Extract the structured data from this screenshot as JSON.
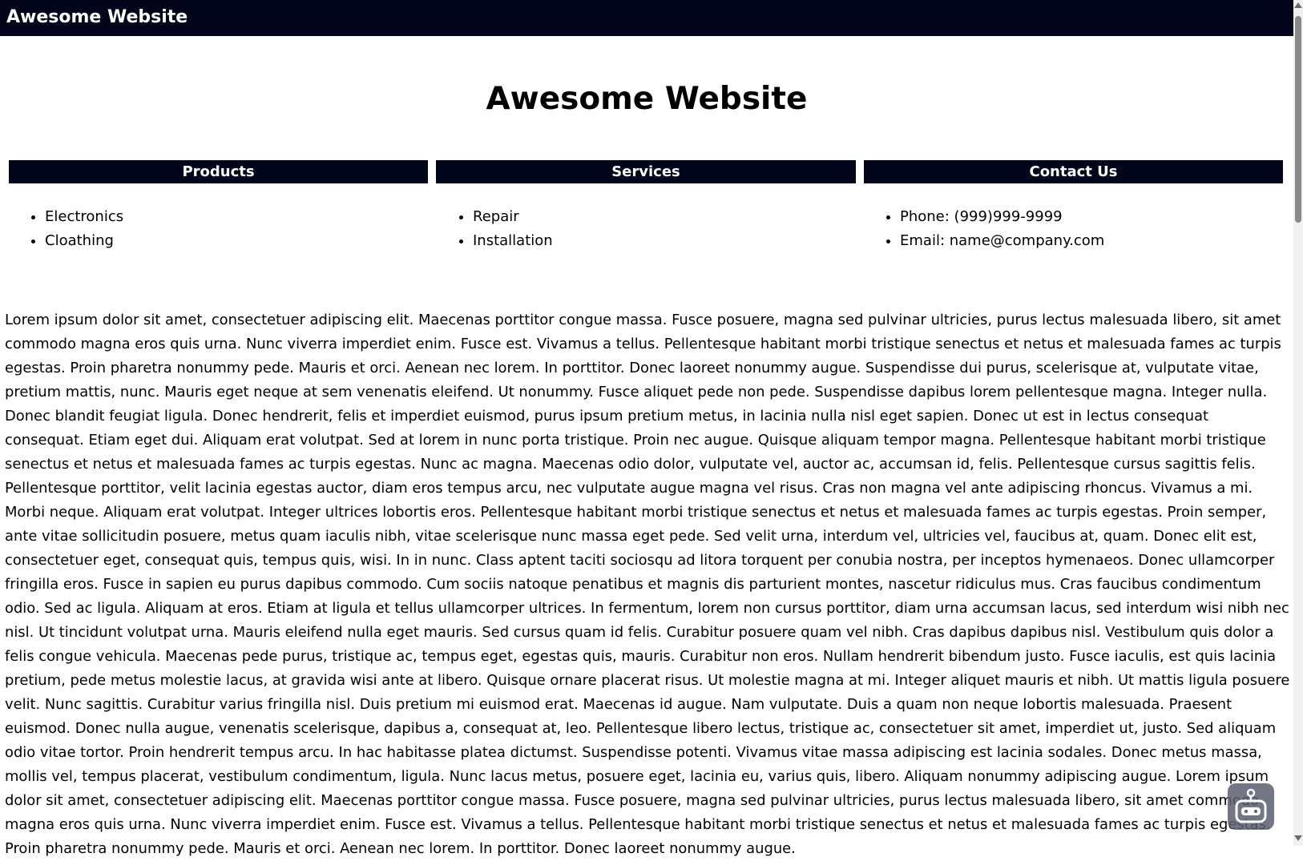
{
  "site": {
    "title": "Awesome Website"
  },
  "hero": {
    "title": "Awesome Website"
  },
  "columns": [
    {
      "header": "Products",
      "items": [
        "Electronics",
        "Cloathing"
      ]
    },
    {
      "header": "Services",
      "items": [
        "Repair",
        "Installation"
      ]
    },
    {
      "header": "Contact Us",
      "items": [
        "Phone: (999)999-9999",
        "Email: name@company.com"
      ]
    }
  ],
  "body_text": "Lorem ipsum dolor sit amet, consectetuer adipiscing elit. Maecenas porttitor congue massa. Fusce posuere, magna sed pulvinar ultricies, purus lectus malesuada libero, sit amet commodo magna eros quis urna. Nunc viverra imperdiet enim. Fusce est. Vivamus a tellus. Pellentesque habitant morbi tristique senectus et netus et malesuada fames ac turpis egestas. Proin pharetra nonummy pede. Mauris et orci. Aenean nec lorem. In porttitor. Donec laoreet nonummy augue. Suspendisse dui purus, scelerisque at, vulputate vitae, pretium mattis, nunc. Mauris eget neque at sem venenatis eleifend. Ut nonummy. Fusce aliquet pede non pede. Suspendisse dapibus lorem pellentesque magna. Integer nulla. Donec blandit feugiat ligula. Donec hendrerit, felis et imperdiet euismod, purus ipsum pretium metus, in lacinia nulla nisl eget sapien. Donec ut est in lectus consequat consequat. Etiam eget dui. Aliquam erat volutpat. Sed at lorem in nunc porta tristique. Proin nec augue. Quisque aliquam tempor magna. Pellentesque habitant morbi tristique senectus et netus et malesuada fames ac turpis egestas. Nunc ac magna. Maecenas odio dolor, vulputate vel, auctor ac, accumsan id, felis. Pellentesque cursus sagittis felis. Pellentesque porttitor, velit lacinia egestas auctor, diam eros tempus arcu, nec vulputate augue magna vel risus. Cras non magna vel ante adipiscing rhoncus. Vivamus a mi. Morbi neque. Aliquam erat volutpat. Integer ultrices lobortis eros. Pellentesque habitant morbi tristique senectus et netus et malesuada fames ac turpis egestas. Proin semper, ante vitae sollicitudin posuere, metus quam iaculis nibh, vitae scelerisque nunc massa eget pede. Sed velit urna, interdum vel, ultricies vel, faucibus at, quam. Donec elit est, consectetuer eget, consequat quis, tempus quis, wisi. In in nunc. Class aptent taciti sociosqu ad litora torquent per conubia nostra, per inceptos hymenaeos. Donec ullamcorper fringilla eros. Fusce in sapien eu purus dapibus commodo. Cum sociis natoque penatibus et magnis dis parturient montes, nascetur ridiculus mus. Cras faucibus condimentum odio. Sed ac ligula. Aliquam at eros. Etiam at ligula et tellus ullamcorper ultrices. In fermentum, lorem non cursus porttitor, diam urna accumsan lacus, sed interdum wisi nibh nec nisl. Ut tincidunt volutpat urna. Mauris eleifend nulla eget mauris. Sed cursus quam id felis. Curabitur posuere quam vel nibh. Cras dapibus dapibus nisl. Vestibulum quis dolor a felis congue vehicula. Maecenas pede purus, tristique ac, tempus eget, egestas quis, mauris. Curabitur non eros. Nullam hendrerit bibendum justo. Fusce iaculis, est quis lacinia pretium, pede metus molestie lacus, at gravida wisi ante at libero. Quisque ornare placerat risus. Ut molestie magna at mi. Integer aliquet mauris et nibh. Ut mattis ligula posuere velit. Nunc sagittis. Curabitur varius fringilla nisl. Duis pretium mi euismod erat. Maecenas id augue. Nam vulputate. Duis a quam non neque lobortis malesuada. Praesent euismod. Donec nulla augue, venenatis scelerisque, dapibus a, consequat at, leo. Pellentesque libero lectus, tristique ac, consectetuer sit amet, imperdiet ut, justo. Sed aliquam odio vitae tortor. Proin hendrerit tempus arcu. In hac habitasse platea dictumst. Suspendisse potenti. Vivamus vitae massa adipiscing est lacinia sodales. Donec metus massa, mollis vel, tempus placerat, vestibulum condimentum, ligula. Nunc lacus metus, posuere eget, lacinia eu, varius quis, libero. Aliquam nonummy adipiscing augue. Lorem ipsum dolor sit amet, consectetuer adipiscing elit. Maecenas porttitor congue massa. Fusce posuere, magna sed pulvinar ultricies, purus lectus malesuada libero, sit amet commodo magna eros quis urna. Nunc viverra imperdiet enim. Fusce est. Vivamus a tellus. Pellentesque habitant morbi tristique senectus et netus et malesuada fames ac turpis egestas. Proin pharetra nonummy pede. Mauris et orci. Aenean nec lorem. In porttitor. Donec laoreet nonummy augue.",
  "colors": {
    "bar": "#03051a",
    "text": "#000000",
    "background": "#ffffff"
  },
  "icons": {
    "floating_widget": "robot-icon"
  }
}
